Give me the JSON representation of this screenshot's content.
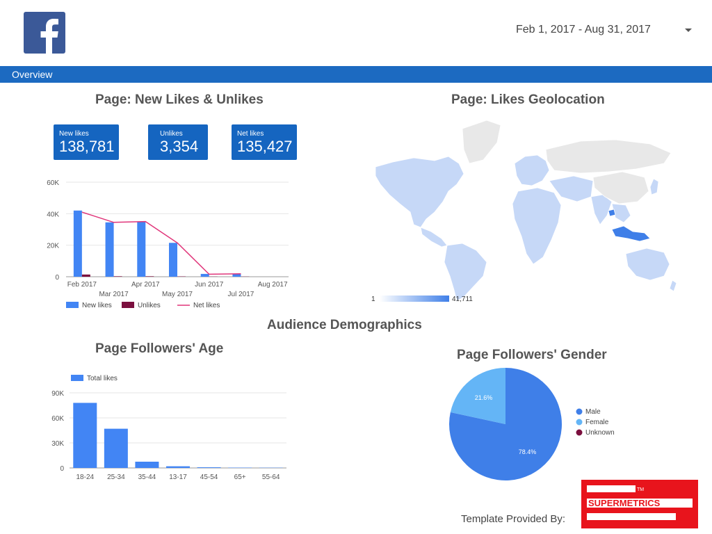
{
  "header": {
    "logo_icon": "facebook-icon",
    "date_range": "Feb 1, 2017 - Aug 31, 2017",
    "dropdown_icon": "caret-down-icon"
  },
  "nav": {
    "overview_label": "Overview",
    "color": "#1c6ac1"
  },
  "likes_section": {
    "title": "Page: New Likes & Unlikes",
    "kpis": [
      {
        "label": "New likes",
        "value": "138,781"
      },
      {
        "label": "Unlikes",
        "value": "3,354"
      },
      {
        "label": "Net likes",
        "value": "135,427"
      }
    ]
  },
  "geo_section": {
    "title": "Page: Likes Geolocation",
    "legend_min": "1",
    "legend_max": "41,711"
  },
  "demographics_title": "Audience Demographics",
  "age_section": {
    "title": "Page Followers' Age"
  },
  "gender_section": {
    "title": "Page Followers' Gender"
  },
  "footer": {
    "label": "Template Provided By:",
    "brand": "SUPERMETRICS",
    "trademark": "TM"
  },
  "chart_data": [
    {
      "type": "bar",
      "categories": [
        "Feb 2017",
        "Mar 2017",
        "Apr 2017",
        "May 2017",
        "Jun 2017",
        "Jul 2017",
        "Aug 2017"
      ],
      "series": [
        {
          "name": "New likes",
          "type": "bar",
          "color": "#4285f4",
          "values": [
            42000,
            34500,
            35000,
            21500,
            1800,
            2000,
            0
          ]
        },
        {
          "name": "Unlikes",
          "type": "bar",
          "color": "#7b0f3e",
          "values": [
            1400,
            300,
            300,
            200,
            100,
            100,
            0
          ]
        },
        {
          "name": "Net likes",
          "type": "line",
          "color": "#e0357a",
          "values": [
            41000,
            34500,
            35000,
            21500,
            1600,
            1900,
            null
          ]
        }
      ],
      "yticks": [
        "0",
        "20K",
        "40K",
        "60K"
      ],
      "ylim": [
        0,
        60000
      ],
      "grid": true,
      "legend": "bottom"
    },
    {
      "type": "bar",
      "categories": [
        "18-24",
        "25-34",
        "35-44",
        "13-17",
        "45-54",
        "65+",
        "55-64"
      ],
      "series": [
        {
          "name": "Total likes",
          "color": "#4285f4",
          "values": [
            78000,
            47000,
            7500,
            2000,
            800,
            400,
            300
          ]
        }
      ],
      "yticks": [
        "0",
        "30K",
        "60K",
        "90K"
      ],
      "ylim": [
        0,
        90000
      ],
      "grid": true,
      "legend": "top-left"
    },
    {
      "type": "pie",
      "series": [
        {
          "name": "Male",
          "value": 78.4,
          "label": "78.4%",
          "color": "#3f7fe8"
        },
        {
          "name": "Female",
          "value": 21.6,
          "label": "21.6%",
          "color": "#64b5f6"
        },
        {
          "name": "Unknown",
          "value": 0,
          "label": "",
          "color": "#7b0f3e"
        }
      ],
      "legend": "right"
    }
  ]
}
